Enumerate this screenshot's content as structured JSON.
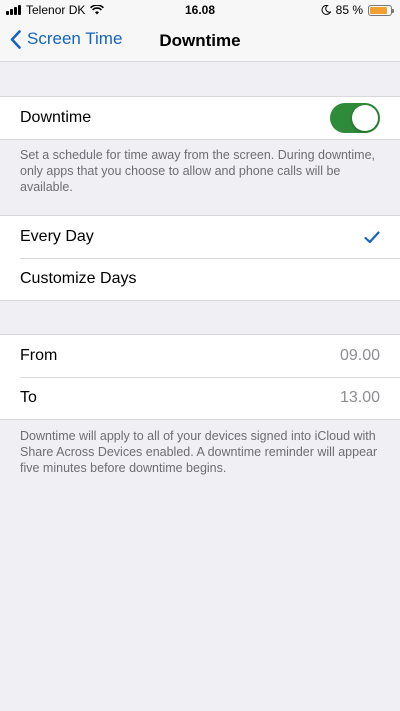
{
  "status_bar": {
    "carrier": "Telenor DK",
    "time": "16.08",
    "battery_percent": "85 %",
    "battery_level": 0.85,
    "icons": [
      "signal-icon",
      "wifi-icon",
      "moon-icon",
      "battery-icon"
    ]
  },
  "nav": {
    "back_label": "Screen Time",
    "title": "Downtime"
  },
  "downtime_toggle": {
    "label": "Downtime",
    "on": true,
    "color": "#2e8b3a"
  },
  "downtime_description": "Set a schedule for time away from the screen. During downtime, only apps that you choose to allow and phone calls will be available.",
  "schedule_options": [
    {
      "label": "Every Day",
      "selected": true
    },
    {
      "label": "Customize Days",
      "selected": false
    }
  ],
  "times": {
    "from_label": "From",
    "from_value": "09.00",
    "to_label": "To",
    "to_value": "13.00"
  },
  "footer_note": "Downtime will apply to all of your devices signed into iCloud with Share Across Devices enabled. A downtime reminder will appear five minutes before downtime begins.",
  "colors": {
    "accent": "#1565c0",
    "background": "#efeff4"
  }
}
